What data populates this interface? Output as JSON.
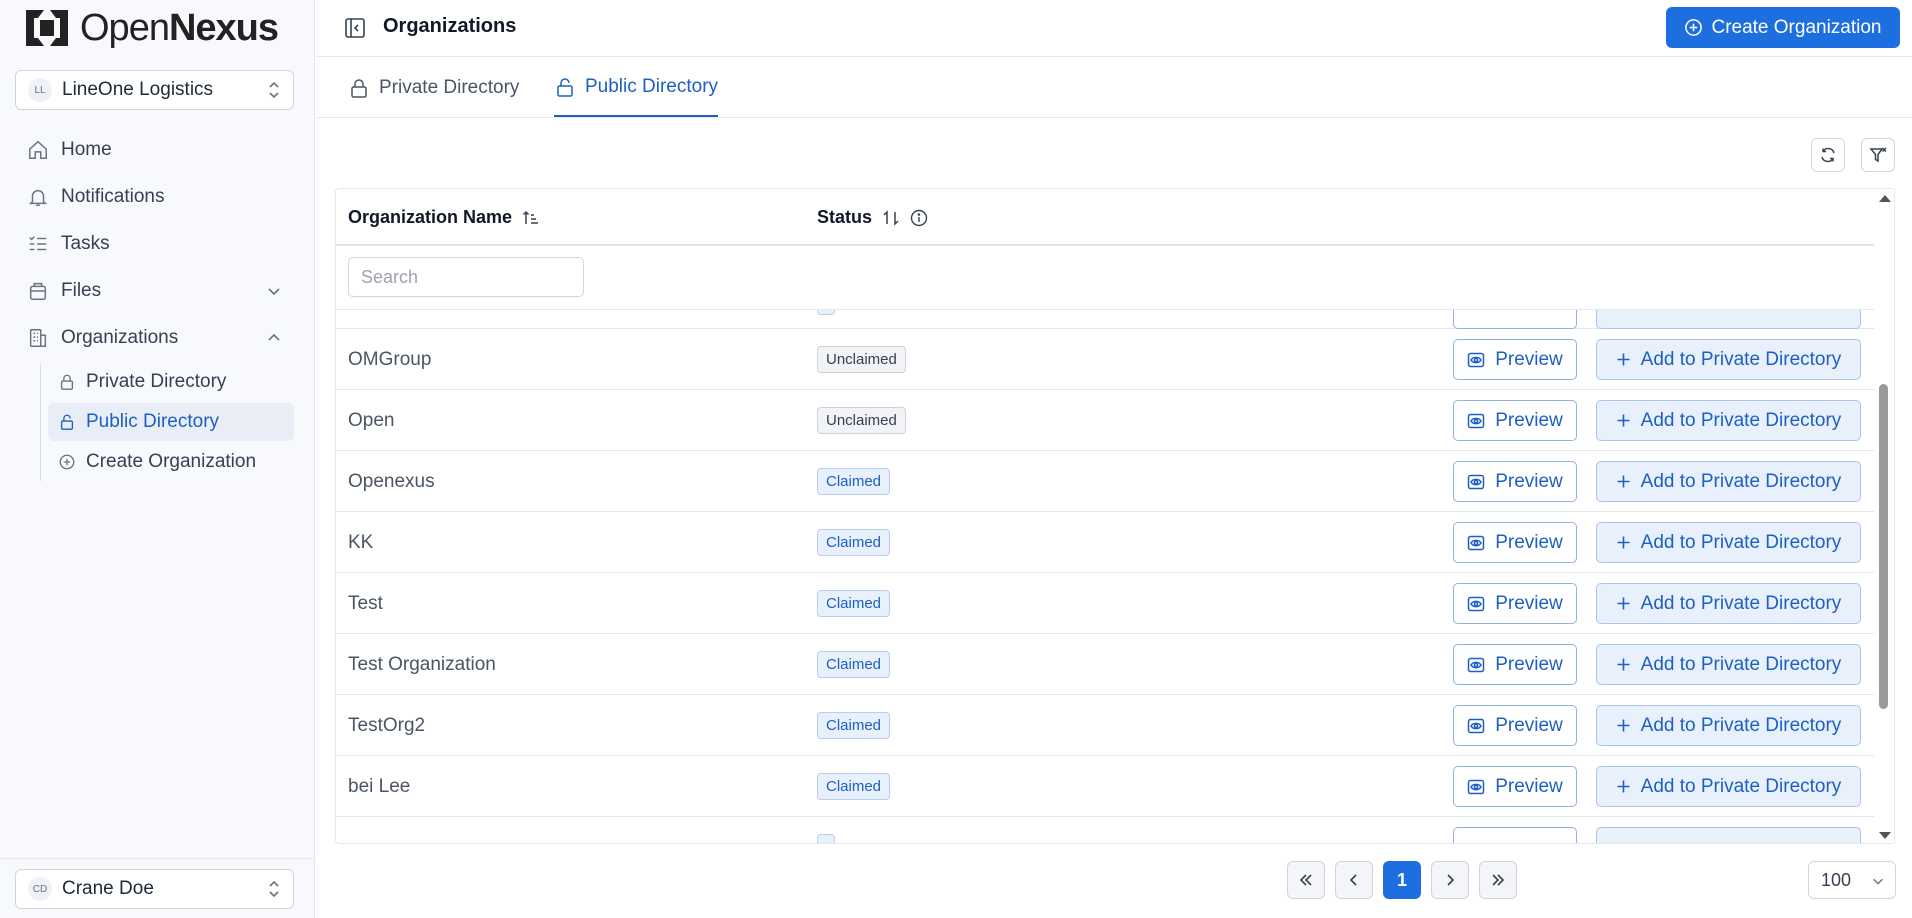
{
  "brand": {
    "name_light": "Open",
    "name_bold": "Nexus"
  },
  "org_switcher": {
    "initials": "LL",
    "name": "LineOne Logistics"
  },
  "nav": {
    "home": "Home",
    "notifications": "Notifications",
    "tasks": "Tasks",
    "files": "Files",
    "organizations": "Organizations",
    "sub": {
      "private": "Private Directory",
      "public": "Public Directory",
      "create": "Create Organization"
    }
  },
  "user_switcher": {
    "initials": "CD",
    "name": "Crane Doe"
  },
  "header": {
    "title": "Organizations",
    "create_button": "Create Organization"
  },
  "tabs": {
    "private": "Private Directory",
    "public": "Public Directory",
    "active": "public"
  },
  "table": {
    "columns": {
      "name": "Organization Name",
      "status": "Status"
    },
    "search_placeholder": "Search",
    "preview_label": "Preview",
    "add_label": "Add to Private Directory",
    "rows": [
      {
        "name": "OMGroup",
        "status": "Unclaimed"
      },
      {
        "name": "Open",
        "status": "Unclaimed"
      },
      {
        "name": "Openexus",
        "status": "Claimed"
      },
      {
        "name": "KK",
        "status": "Claimed"
      },
      {
        "name": "Test",
        "status": "Claimed"
      },
      {
        "name": "Test Organization",
        "status": "Claimed"
      },
      {
        "name": "TestOrg2",
        "status": "Claimed"
      },
      {
        "name": "bei Lee",
        "status": "Claimed"
      }
    ]
  },
  "pagination": {
    "current_page": "1",
    "page_size": "100"
  },
  "colors": {
    "accent": "#1d6fe0",
    "active_text": "#1d5fc4"
  }
}
